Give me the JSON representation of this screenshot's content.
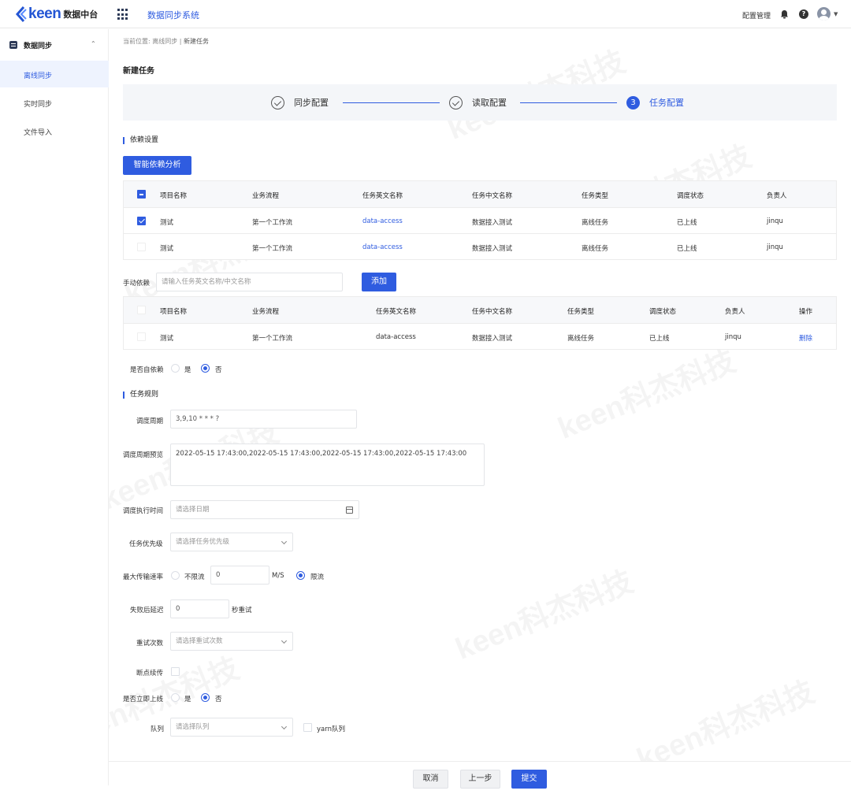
{
  "header": {
    "logo_text": "keen",
    "logo_sub": "数据中台",
    "system_title": "数据同步系统",
    "config_link": "配置管理"
  },
  "sidebar": {
    "group_label": "数据同步",
    "items": [
      {
        "label": "离线同步",
        "active": true
      },
      {
        "label": "实时同步",
        "active": false
      },
      {
        "label": "文件导入",
        "active": false
      }
    ]
  },
  "breadcrumb": {
    "prefix": "当前位置:",
    "parent": "离线同步",
    "separator": "|",
    "current": "新建任务"
  },
  "page_title": "新建任务",
  "steps": [
    {
      "label": "同步配置",
      "status": "done"
    },
    {
      "label": "读取配置",
      "status": "done"
    },
    {
      "label": "任务配置",
      "status": "active",
      "number": "3"
    }
  ],
  "dependency": {
    "section_title": "依赖设置",
    "analyze_button": "智能依赖分析",
    "table1": {
      "headers": [
        "项目名称",
        "业务流程",
        "任务英文名称",
        "任务中文名称",
        "任务类型",
        "调度状态",
        "负责人"
      ],
      "rows": [
        {
          "checked": true,
          "cells": [
            "测试",
            "第一个工作流",
            "data-access",
            "数据接入测试",
            "离线任务",
            "已上线",
            "jinqu"
          ]
        },
        {
          "checked": false,
          "cells": [
            "测试",
            "第一个工作流",
            "data-access",
            "数据接入测试",
            "离线任务",
            "已上线",
            "jinqu"
          ]
        }
      ]
    },
    "manual_label": "手动依赖",
    "manual_placeholder": "请输入任务英文名称/中文名称",
    "add_button": "添加",
    "table2": {
      "headers": [
        "项目名称",
        "业务流程",
        "任务英文名称",
        "任务中文名称",
        "任务类型",
        "调度状态",
        "负责人",
        "操作"
      ],
      "rows": [
        {
          "cells": [
            "测试",
            "第一个工作流",
            "data-access",
            "数据接入测试",
            "离线任务",
            "已上线",
            "jinqu"
          ],
          "action": "删除"
        }
      ]
    },
    "self_dep_label": "是否自依赖",
    "self_dep_yes": "是",
    "self_dep_no": "否",
    "self_dep_value": "否"
  },
  "rules": {
    "section_title": "任务规则",
    "cycle_label": "调度周期",
    "cycle_value": "3,9,10 * * * ?",
    "preview_label": "调度周期预览",
    "preview_value": "2022-05-15 17:43:00,2022-05-15 17:43:00,2022-05-15 17:43:00,2022-05-15 17:43:00",
    "exec_time_label": "调度执行时间",
    "exec_time_placeholder": "请选择日期",
    "priority_label": "任务优先级",
    "priority_placeholder": "请选择任务优先级",
    "rate_label": "最大传输速率",
    "rate_unlimited": "不限流",
    "rate_value": "0",
    "rate_unit": "M/S",
    "rate_limited": "限流",
    "retry_delay_label": "失败后延迟",
    "retry_delay_value": "0",
    "retry_delay_unit": "秒重试",
    "retry_count_label": "重试次数",
    "retry_count_placeholder": "请选择重试次数",
    "resume_label": "断点续传",
    "online_label": "是否立即上线",
    "online_yes": "是",
    "online_no": "否",
    "queue_label": "队列",
    "queue_placeholder": "请选择队列",
    "yarn_label": "yarn队列"
  },
  "footer": {
    "cancel": "取消",
    "prev": "上一步",
    "submit": "提交"
  },
  "watermark": "keen科杰科技",
  "colors": {
    "primary": "#2f5ce0",
    "sidebar_active_bg": "#eef3fe"
  }
}
